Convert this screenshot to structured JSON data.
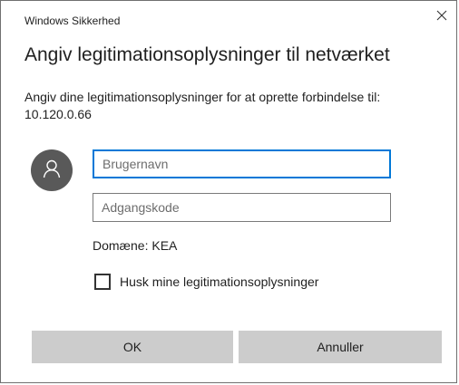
{
  "window": {
    "title": "Windows Sikkerhed",
    "close_icon": "close-icon"
  },
  "dialog": {
    "heading": "Angiv legitimationsoplysninger til netværket",
    "description": "Angiv dine legitimationsoplysninger for at oprette forbindelse til: 10.120.0.66",
    "avatar_icon": "user-icon",
    "username": {
      "placeholder": "Brugernavn",
      "value": ""
    },
    "password": {
      "placeholder": "Adgangskode",
      "value": ""
    },
    "domain_text": "Domæne: KEA",
    "remember": {
      "label": "Husk mine legitimationsoplysninger",
      "checked": false
    },
    "buttons": {
      "ok_label": "OK",
      "cancel_label": "Annuller"
    }
  },
  "colors": {
    "accent": "#0078d7",
    "button_bg": "#cccccc",
    "avatar_bg": "#595959"
  }
}
